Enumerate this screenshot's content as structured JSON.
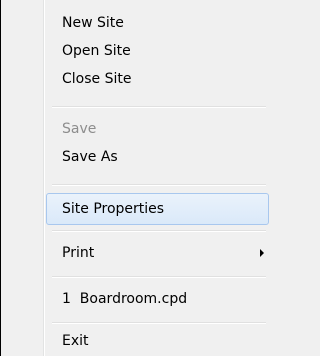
{
  "menu": {
    "items": {
      "new_site": "New Site",
      "open_site": "Open Site",
      "close_site": "Close Site",
      "save": "Save",
      "save_as": "Save As",
      "site_properties": "Site Properties",
      "print": "Print",
      "recent_file": "1  Boardroom.cpd",
      "exit": "Exit"
    },
    "disabled_items": [
      "save"
    ],
    "highlighted_item": "site_properties",
    "submenu_icon": "chevron-right-icon"
  }
}
